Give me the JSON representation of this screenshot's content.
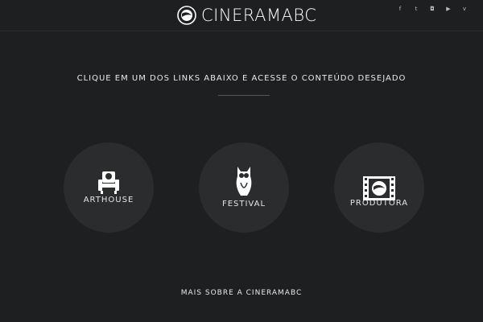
{
  "header": {
    "logo_text": "CINERAMABC",
    "social": [
      {
        "icon": "facebook-icon",
        "glyph": "f"
      },
      {
        "icon": "twitter-icon",
        "glyph": "t"
      },
      {
        "icon": "instagram-icon",
        "glyph": "◘"
      },
      {
        "icon": "youtube-icon",
        "glyph": "▶"
      },
      {
        "icon": "vimeo-icon",
        "glyph": "v"
      }
    ]
  },
  "main": {
    "intro": "CLIQUE EM UM DOS LINKS ABAIXO E ACESSE O CONTEÚDO DESEJADO",
    "links": [
      {
        "label": "ARTHOUSE",
        "icon": "cinema-seat-icon"
      },
      {
        "label": "FESTIVAL",
        "icon": "owl-icon"
      },
      {
        "label": "PRODUTORA",
        "icon": "film-strip-icon"
      }
    ],
    "more": "MAIS SOBRE A CINERAMABC"
  },
  "colors": {
    "background": "#1e1f21",
    "circle": "#2b2c2e",
    "text": "#ffffff"
  }
}
